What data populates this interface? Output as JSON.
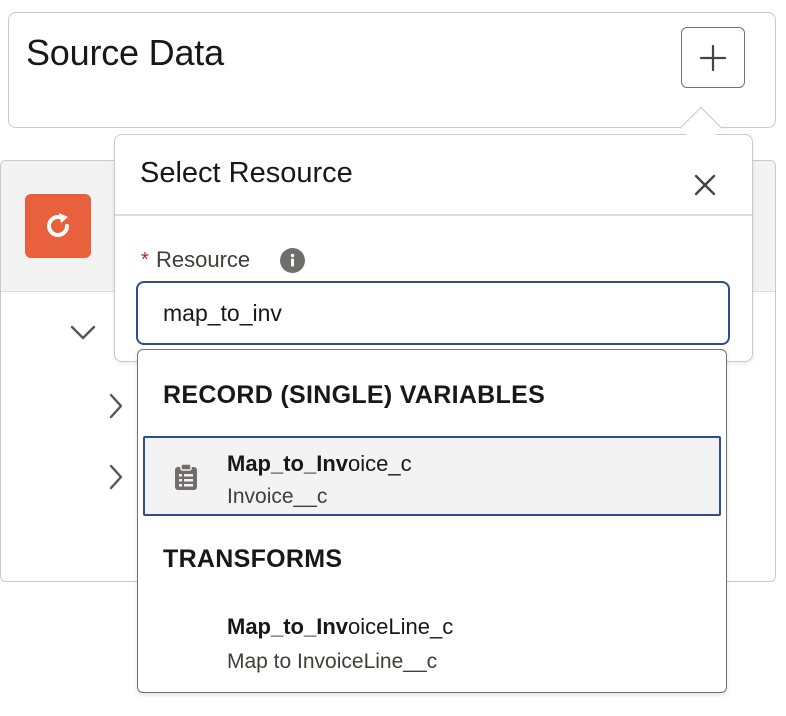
{
  "source_data": {
    "title": "Source Data",
    "add_icon": "plus-icon"
  },
  "background_panel": {
    "refresh_icon": "refresh-icon",
    "refresh_color": "#e8603c"
  },
  "popover": {
    "title": "Select Resource",
    "close_icon": "close-icon",
    "field": {
      "required_marker": "*",
      "label": "Resource",
      "info_icon": "info-icon",
      "value": "map_to_inv"
    }
  },
  "dropdown": {
    "groups": [
      {
        "header": "RECORD (SINGLE) VARIABLES",
        "options": [
          {
            "title_match": "Map_to_Inv",
            "title_rest": "oice_c",
            "subtitle": "Invoice__c",
            "icon": "clipboard-icon",
            "highlighted": true
          }
        ]
      },
      {
        "header": "TRANSFORMS",
        "options": [
          {
            "title_match": "Map_to_Inv",
            "title_rest": "oiceLine_c",
            "subtitle": "Map to InvoiceLine__c",
            "highlighted": false
          }
        ]
      }
    ]
  },
  "colors": {
    "focus_border": "#2e4d8f",
    "required": "#b32222"
  }
}
